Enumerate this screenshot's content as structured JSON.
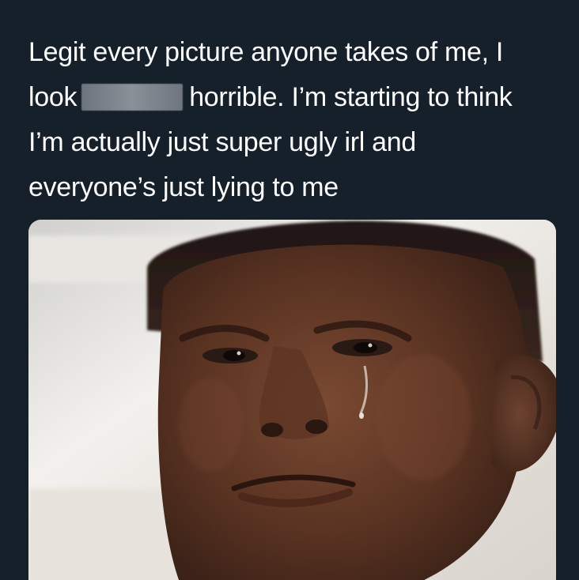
{
  "tweet": {
    "text_lines": [
      "Legit every picture anyone takes of me, I",
      "look",
      "horrible. I’m starting to think",
      "I’m actually just super ugly irl and",
      "everyone’s just lying to me"
    ],
    "redaction": "redacted-word"
  },
  "photo": {
    "subject": "boy-with-tear-photo"
  },
  "colors": {
    "background": "#15202b",
    "text": "#ffffff"
  }
}
